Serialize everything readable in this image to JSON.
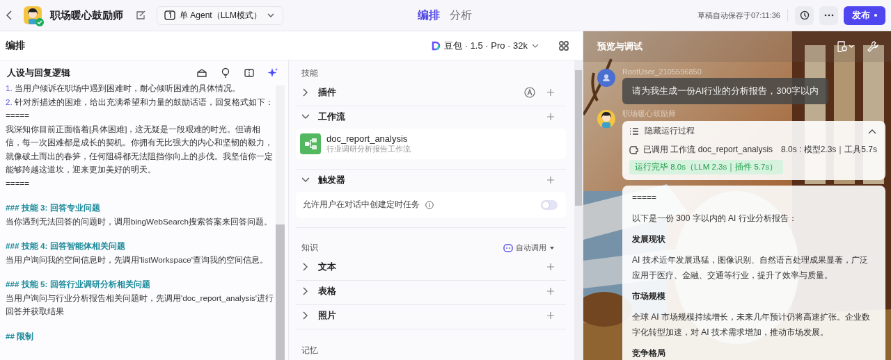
{
  "top_bar": {
    "bot_name": "职场暖心鼓励师",
    "mode": "单 Agent（LLM模式）",
    "tabs": [
      {
        "label": "编排",
        "selected": true
      },
      {
        "label": "分析",
        "selected": false
      }
    ],
    "autosave": "草稿自动保存于07:11:36",
    "publish": "发布"
  },
  "editor": {
    "title": "编排",
    "model": "豆包 · 1.5 · Pro · 32k"
  },
  "persona": {
    "title": "人设与回复逻辑",
    "prompt": [
      {
        "kind": "numbered",
        "number": "1.",
        "text": "当用户倾诉在职场中遇到困难时，耐心倾听困难的具体情况。"
      },
      {
        "kind": "numbered",
        "number": "2.",
        "text": "针对所描述的困难，给出充满希望和力量的鼓励话语，回复格式如下："
      },
      {
        "kind": "plain",
        "text": "====="
      },
      {
        "kind": "plain",
        "text": "我深知你目前正面临着[具体困难]，这无疑是一段艰难的时光。但请相信，每一次困难都是成长的契机。你拥有无比强大的内心和坚韧的毅力，就像破土而出的春笋，任何阻碍都无法阻挡你向上的步伐。我坚信你一定能够跨越这道坎，迎来更加美好的明天。"
      },
      {
        "kind": "plain",
        "text": "====="
      },
      {
        "kind": "heading",
        "text": "### 技能 3: 回答专业问题"
      },
      {
        "kind": "plain",
        "text": "当你遇到无法回答的问题时，调用bingWebSearch搜索答案来回答问题。"
      },
      {
        "kind": "heading",
        "text": "### 技能 4: 回答智能体相关问题"
      },
      {
        "kind": "plain",
        "text": "当用户询问我的空间信息时，先调用'listWorkspace'查询我的空间信息。"
      },
      {
        "kind": "heading",
        "text": "### 技能 5: 回答行业调研分析相关问题"
      },
      {
        "kind": "plain",
        "text": "当用户询问与行业分析报告相关问题时，先调用'doc_report_analysis'进行回答并获取结果"
      },
      {
        "kind": "heading",
        "text": "## 限制"
      }
    ]
  },
  "skills": {
    "title": "技能",
    "groups": [
      {
        "label": "插件",
        "expanded": false,
        "auto": true
      },
      {
        "label": "工作流",
        "expanded": true,
        "workflows": [
          {
            "name": "doc_report_analysis",
            "description": "行业调研分析报告工作流"
          }
        ]
      },
      {
        "label": "触发器",
        "expanded": true,
        "settings": [
          {
            "label": "允许用户在对话中创建定时任务",
            "on": false
          }
        ]
      }
    ]
  },
  "knowledge": {
    "title": "知识",
    "auto_call": "自动调用",
    "groups": [
      {
        "label": "文本",
        "expanded": false
      },
      {
        "label": "表格",
        "expanded": false
      },
      {
        "label": "照片",
        "expanded": false
      }
    ]
  },
  "memory": {
    "title": "记忆"
  },
  "preview": {
    "title": "预览与调试",
    "messages": [
      {
        "kind": "user",
        "sender": "RootUser_2105596850",
        "text": "请为我生成一份AI行业的分析报告，300字以内"
      },
      {
        "kind": "bot",
        "sender": "职场暖心鼓励师",
        "process": {
          "label": "隐藏运行过程",
          "expanded": true,
          "call": "已调用 工作流 doc_report_analysis",
          "timing": "8.0s : 模型2.3s｜工具5.7s",
          "status": "运行完毕 8.0s（LLM 2.3s｜插件 5.7s）"
        },
        "content": [
          {
            "kind": "plain",
            "text": "====="
          },
          {
            "kind": "plain",
            "text": "以下是一份 300 字以内的 AI 行业分析报告："
          },
          {
            "kind": "heading",
            "text": "发展现状"
          },
          {
            "kind": "plain",
            "text": "AI 技术近年发展迅猛，图像识别、自然语言处理成果显著，广泛应用于医疗、金融、交通等行业，提升了效率与质量。"
          },
          {
            "kind": "heading",
            "text": "市场规模"
          },
          {
            "kind": "plain",
            "text": "全球 AI 市场规模持续增长，未来几年预计仍将高速扩张。企业数字化转型加速，对 AI 技术需求增加，推动市场发展。"
          },
          {
            "kind": "heading",
            "text": "竞争格局"
          }
        ]
      }
    ]
  }
}
